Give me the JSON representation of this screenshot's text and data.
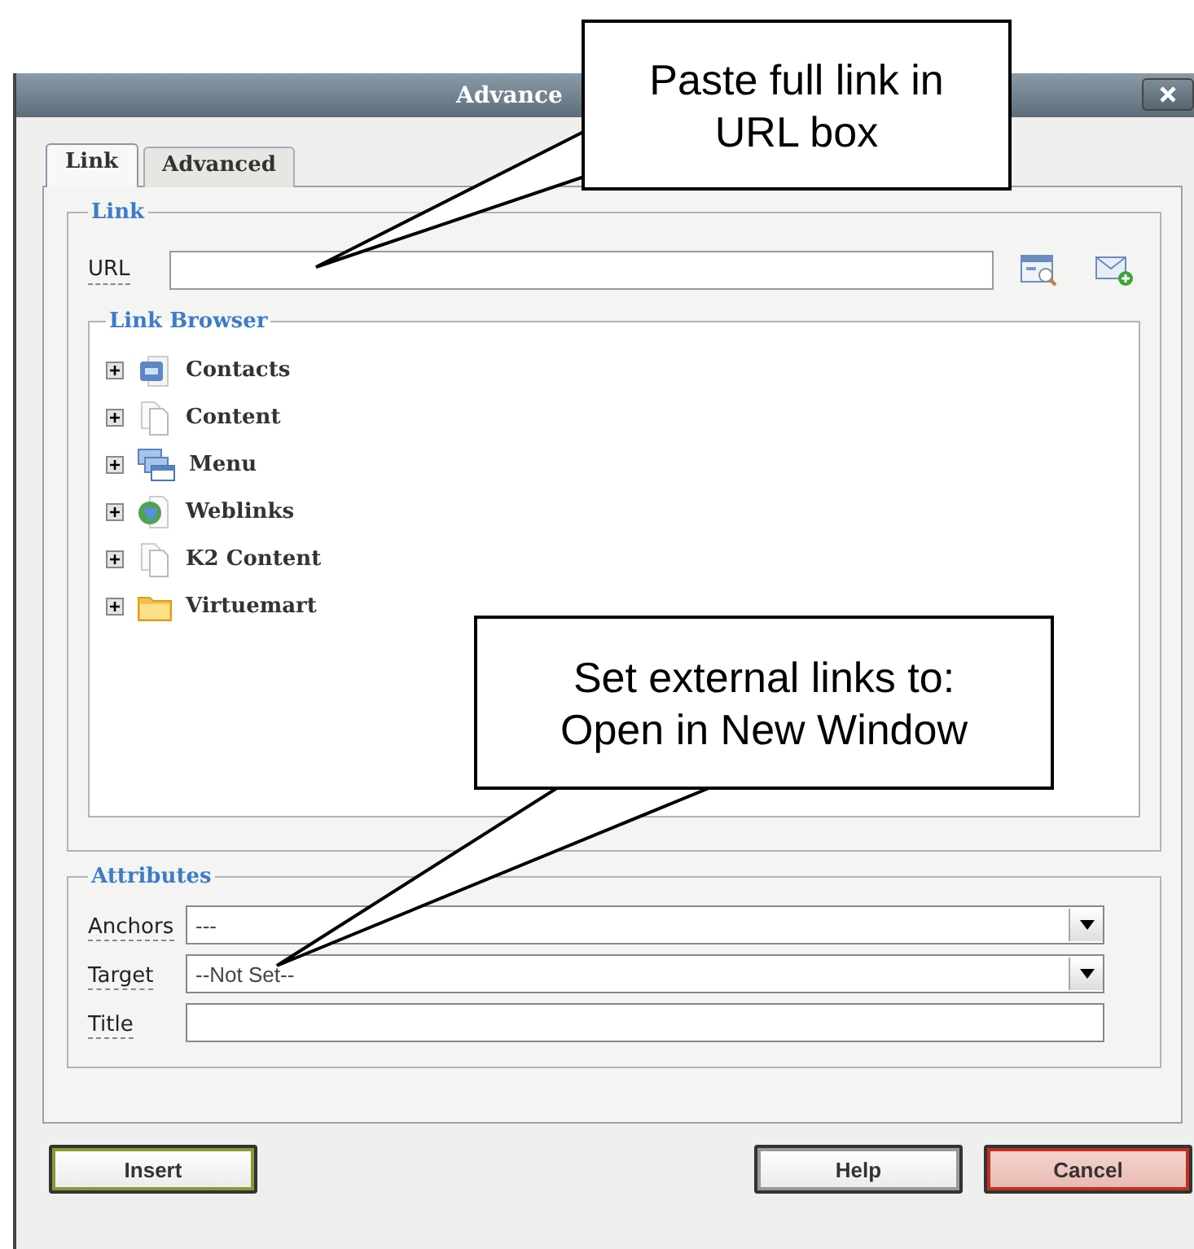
{
  "window": {
    "title": "Advance"
  },
  "tabs": [
    {
      "label": "Link",
      "selected": true
    },
    {
      "label": "Advanced",
      "selected": false
    }
  ],
  "link_section": {
    "legend": "Link",
    "url_label": "URL"
  },
  "link_browser": {
    "legend": "Link Browser",
    "items": [
      {
        "label": "Contacts",
        "kind": "contacts",
        "expanded": false
      },
      {
        "label": "Content",
        "kind": "page",
        "expanded": false
      },
      {
        "label": "Menu",
        "kind": "menu",
        "expanded": false
      },
      {
        "label": "Weblinks",
        "kind": "globe",
        "expanded": false
      },
      {
        "label": "K2 Content",
        "kind": "page",
        "expanded": false
      },
      {
        "label": "Virtuemart",
        "kind": "folder",
        "expanded": false
      }
    ]
  },
  "attributes": {
    "legend": "Attributes",
    "fields": [
      {
        "label": "Anchors",
        "kind": "select",
        "value": "---"
      },
      {
        "label": "Target",
        "kind": "select",
        "value": "--Not Set--"
      },
      {
        "label": "Title",
        "kind": "text"
      }
    ]
  },
  "buttons": [
    {
      "label": "Insert",
      "kind": "insert"
    },
    {
      "label": "Help",
      "kind": "plain"
    },
    {
      "label": "Cancel",
      "kind": "cancel"
    }
  ],
  "callouts": [
    {
      "lines": [
        "Paste full link in",
        "URL box"
      ]
    },
    {
      "lines": [
        "Set external links to:",
        "Open in New Window"
      ]
    }
  ]
}
